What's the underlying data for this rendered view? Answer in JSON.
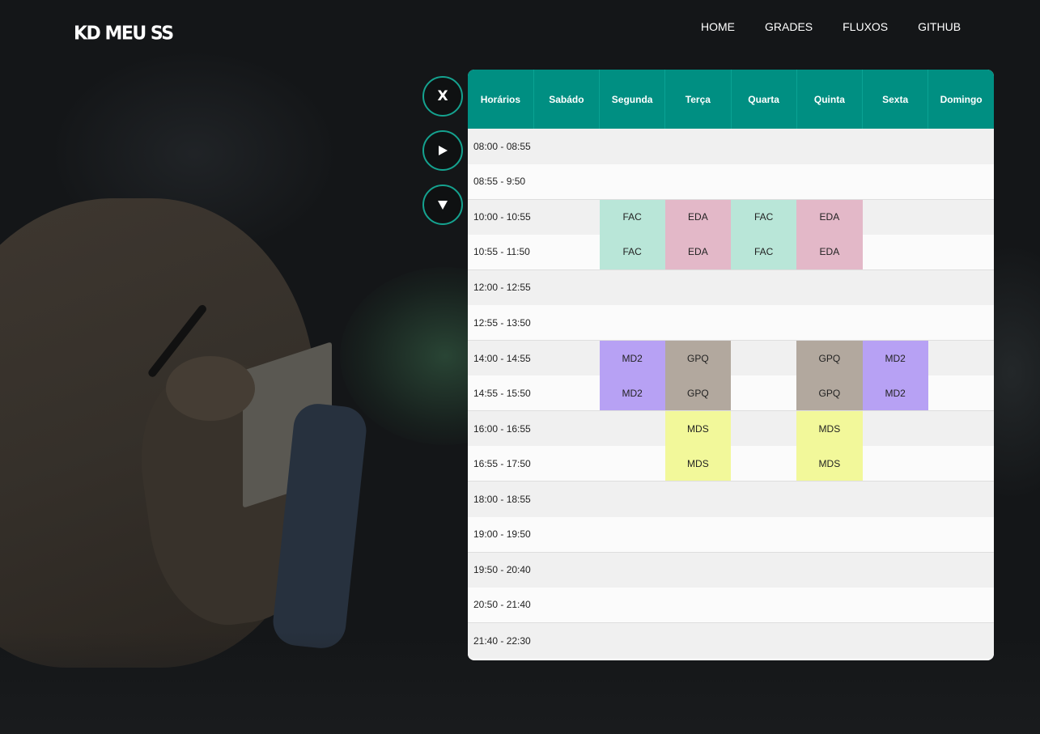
{
  "app": {
    "logo": "KD MEU SS"
  },
  "nav": [
    "HOME",
    "GRADES",
    "FLUXOS",
    "GITHUB"
  ],
  "controls": {
    "clear_label": "X"
  },
  "schedule": {
    "headers": [
      "Horários",
      "Sabádo",
      "Segunda",
      "Terça",
      "Quarta",
      "Quinta",
      "Sexta",
      "Domingo"
    ],
    "rows": [
      {
        "time": "08:00 - 08:55",
        "cells": [
          "",
          "",
          "",
          "",
          "",
          "",
          ""
        ]
      },
      {
        "time": "08:55 - 9:50",
        "cells": [
          "",
          "",
          "",
          "",
          "",
          "",
          ""
        ]
      },
      {
        "time": "10:00 - 10:55",
        "cells": [
          "",
          "FAC",
          "EDA",
          "FAC",
          "EDA",
          "",
          ""
        ]
      },
      {
        "time": "10:55 - 11:50",
        "cells": [
          "",
          "FAC",
          "EDA",
          "FAC",
          "EDA",
          "",
          ""
        ]
      },
      {
        "time": "12:00 - 12:55",
        "cells": [
          "",
          "",
          "",
          "",
          "",
          "",
          ""
        ]
      },
      {
        "time": "12:55 - 13:50",
        "cells": [
          "",
          "",
          "",
          "",
          "",
          "",
          ""
        ]
      },
      {
        "time": "14:00 - 14:55",
        "cells": [
          "",
          "MD2",
          "GPQ",
          "",
          "GPQ",
          "MD2",
          ""
        ]
      },
      {
        "time": "14:55 - 15:50",
        "cells": [
          "",
          "MD2",
          "GPQ",
          "",
          "GPQ",
          "MD2",
          ""
        ]
      },
      {
        "time": "16:00 - 16:55",
        "cells": [
          "",
          "",
          "MDS",
          "",
          "MDS",
          "",
          ""
        ]
      },
      {
        "time": "16:55 - 17:50",
        "cells": [
          "",
          "",
          "MDS",
          "",
          "MDS",
          "",
          ""
        ]
      },
      {
        "time": "18:00 - 18:55",
        "cells": [
          "",
          "",
          "",
          "",
          "",
          "",
          ""
        ]
      },
      {
        "time": "19:00 - 19:50",
        "cells": [
          "",
          "",
          "",
          "",
          "",
          "",
          ""
        ]
      },
      {
        "time": "19:50 - 20:40",
        "cells": [
          "",
          "",
          "",
          "",
          "",
          "",
          ""
        ]
      },
      {
        "time": "20:50 - 21:40",
        "cells": [
          "",
          "",
          "",
          "",
          "",
          "",
          ""
        ]
      },
      {
        "time": "21:40 - 22:30",
        "cells": [
          "",
          "",
          "",
          "",
          "",
          "",
          ""
        ]
      }
    ],
    "subject_colors": {
      "FAC": "#b9e6d8",
      "EDA": "#e3b8c8",
      "MD2": "#b7a1f4",
      "GPQ": "#b2a89e",
      "MDS": "#f2f89a"
    },
    "header_color": "#008f82"
  },
  "icons": {
    "play": "play-icon",
    "down": "triangle-down-icon"
  }
}
